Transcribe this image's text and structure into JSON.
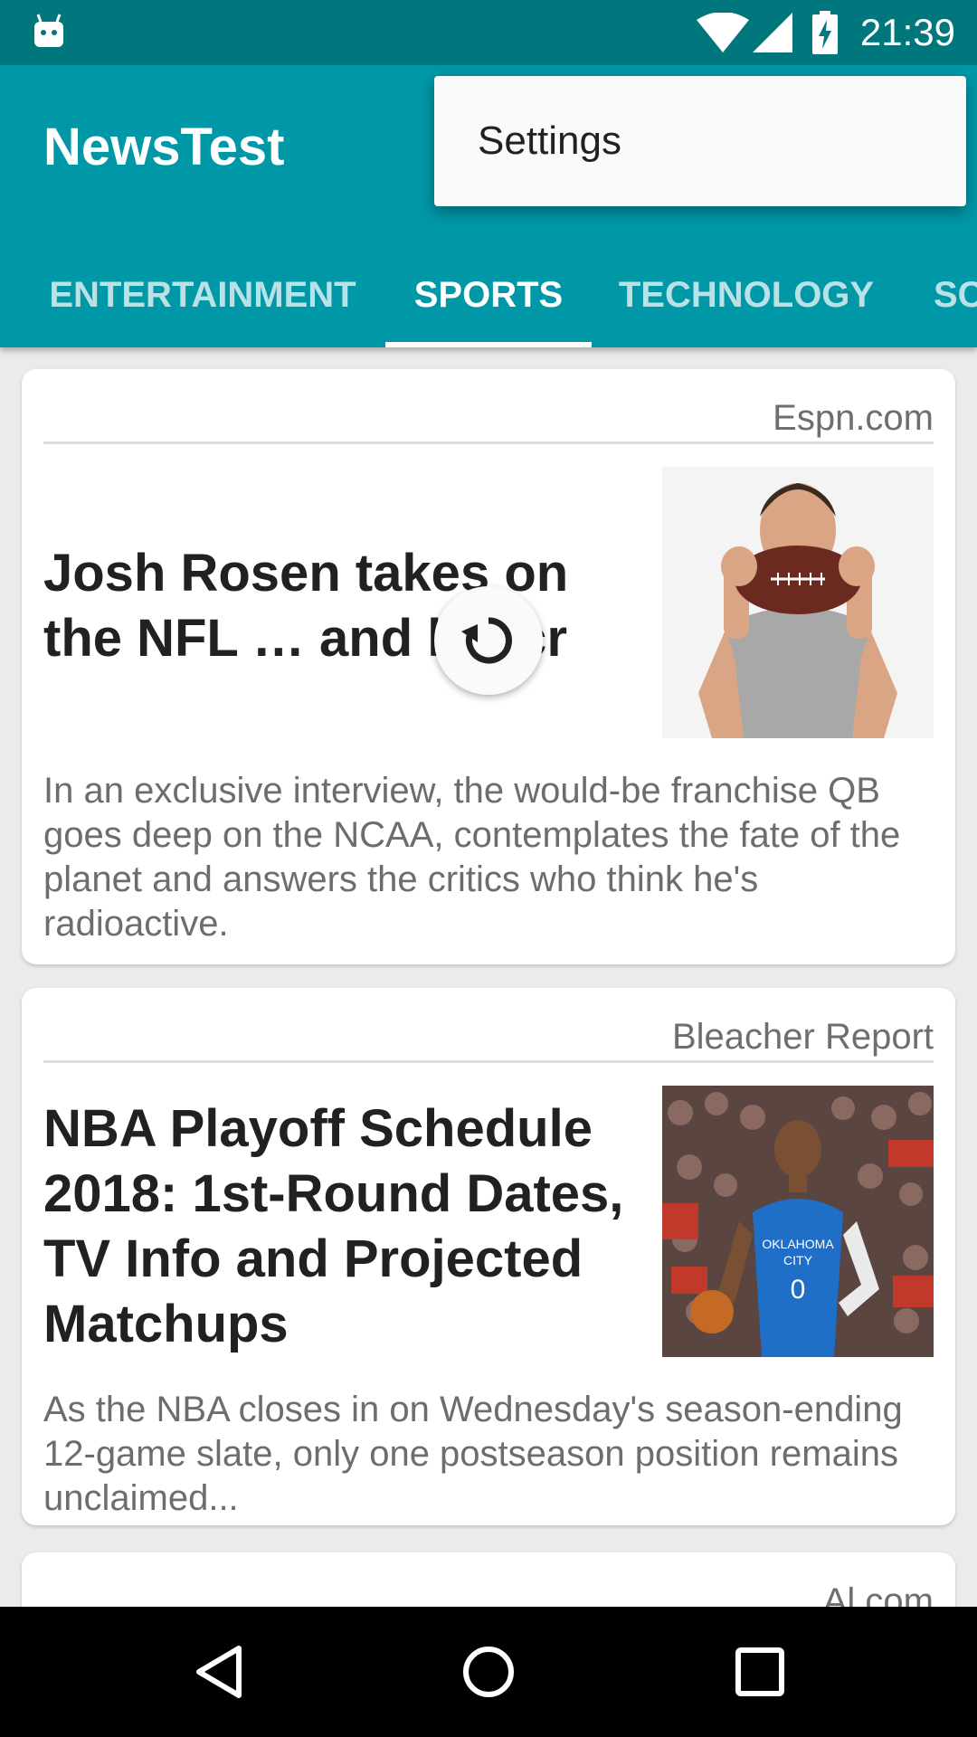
{
  "status_bar": {
    "time": "21:39",
    "icons": [
      "android-icon",
      "wifi-icon",
      "signal-icon",
      "battery-charging-icon"
    ]
  },
  "app_bar": {
    "title": "NewsTest",
    "tabs": [
      {
        "label": "ENTERTAINMENT",
        "active": false
      },
      {
        "label": "SPORTS",
        "active": true
      },
      {
        "label": "TECHNOLOGY",
        "active": false
      },
      {
        "label": "SCIENCE",
        "active": false
      }
    ]
  },
  "overflow_menu": {
    "items": [
      {
        "label": "Settings"
      }
    ]
  },
  "articles": [
    {
      "source": "Espn.com",
      "headline": "Josh Rosen takes on the NFL … and his cr",
      "description": "In an exclusive interview, the would-be franchise QB goes deep on the NCAA, contemplates the fate of the planet and answers the critics who think he's radioactive."
    },
    {
      "source": "Bleacher Report",
      "headline": "NBA Playoff Schedule 2018: 1st-Round Dates, TV Info and Projected Matchups",
      "description": "As the  NBA  closes in on Wednesday's season-ending 12-game slate, only one postseason position remains unclaimed..."
    },
    {
      "source": "Al.com"
    }
  ],
  "refresh_indicator": {
    "icon": "refresh-icon"
  },
  "nav_bar": {
    "icons": [
      "back-icon",
      "home-icon",
      "recents-icon"
    ]
  },
  "colors": {
    "primary": "#0097a7",
    "primary_dark": "#00767d",
    "background": "#ebebeb"
  }
}
